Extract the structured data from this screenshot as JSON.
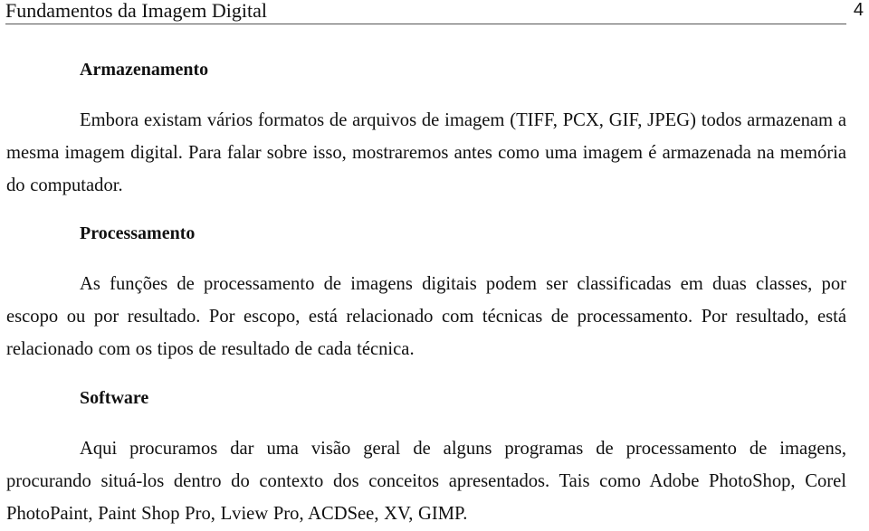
{
  "header": {
    "title": "Fundamentos da Imagem Digital",
    "page_number": "4"
  },
  "sections": [
    {
      "heading": "Armazenamento",
      "paragraph": "Embora existam vários formatos de arquivos de imagem (TIFF, PCX, GIF, JPEG) todos armazenam a mesma imagem digital. Para falar sobre isso, mostraremos antes como uma imagem é armazenada na memória do computador."
    },
    {
      "heading": "Processamento",
      "paragraph": "As funções de processamento de imagens digitais podem ser classificadas em duas classes, por escopo ou por resultado. Por escopo, está relacionado com técnicas de processamento. Por resultado, está relacionado com os tipos de resultado de cada técnica."
    },
    {
      "heading": "Software",
      "paragraph": "Aqui procuramos dar uma visão geral de alguns programas de processamento de imagens, procurando situá-los dentro do contexto dos conceitos apresentados. Tais como Adobe PhotoShop, Corel PhotoPaint, Paint Shop Pro, Lview Pro, ACDSee, XV, GIMP."
    }
  ]
}
